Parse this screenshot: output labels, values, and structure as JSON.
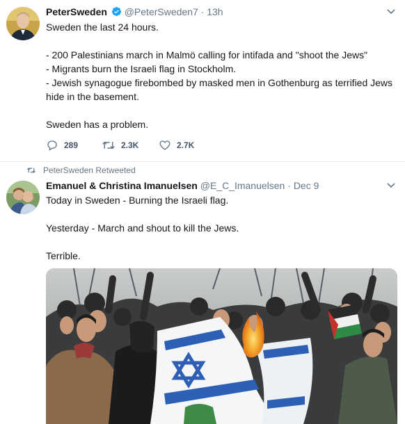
{
  "tweet1": {
    "display_name": "PeterSweden",
    "handle": "@PeterSweden7",
    "separator": "·",
    "time": "13h",
    "avatar_icon": "user-avatar-icon",
    "lines": [
      "Sweden the last 24 hours.",
      "",
      "- 200 Palestinians march in Malmö calling for intifada and \"shoot the Jews\"",
      "- Migrants burn the Israeli flag in Stockholm.",
      "- Jewish synagogue firebombed by masked men in Gothenburg as terrified Jews",
      "hide in the basement.",
      "",
      "Sweden has a problem."
    ],
    "replies": "289",
    "retweets": "2.3K",
    "likes": "2.7K"
  },
  "retweet_context": {
    "label": "PeterSweden Retweeted"
  },
  "tweet2": {
    "display_name": "Emanuel & Christina Imanuelsen",
    "handle": "@E_C_Imanuelsen",
    "separator": "·",
    "time": "Dec 9",
    "lines": [
      "Today in Sweden - Burning the Israeli flag.",
      "",
      "Yesterday - March and shout to kill the Jews.",
      "",
      "Terrible."
    ]
  },
  "colors": {
    "verified_blue": "#1da1f2",
    "secondary_text": "#657786",
    "flag_blue": "#2d5fb5",
    "fire": "#f2a025"
  }
}
